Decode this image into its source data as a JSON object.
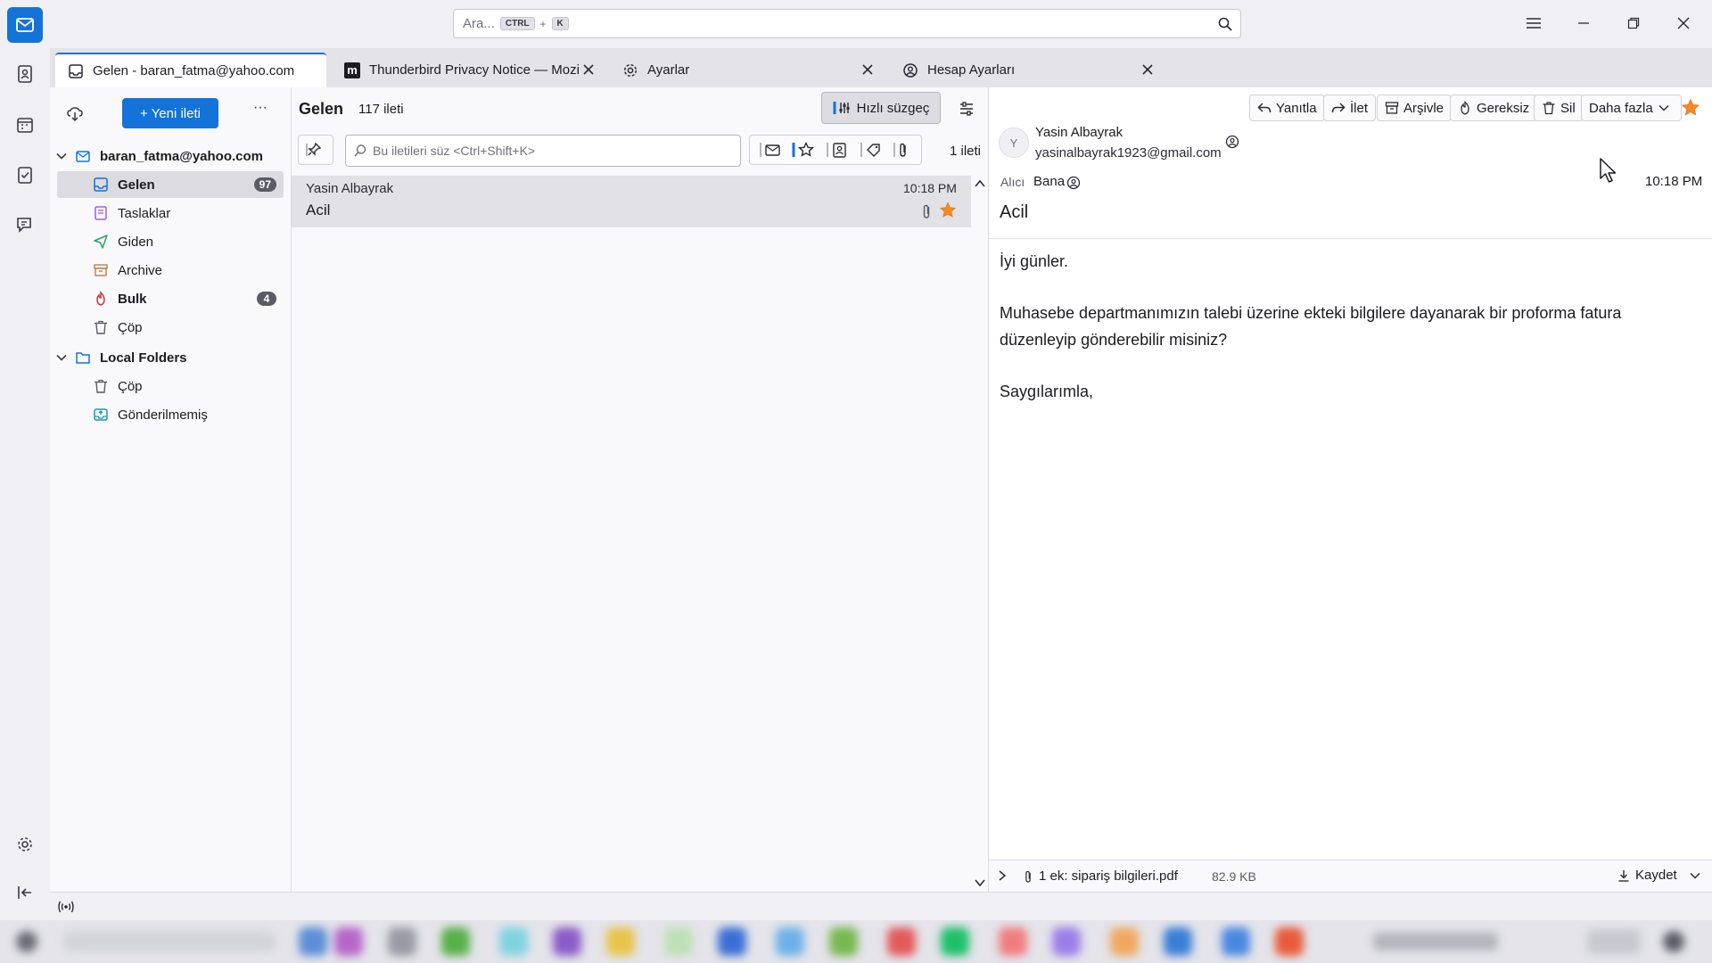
{
  "search": {
    "placeholder": "Ara...",
    "kbd_ctrl": "CTRL",
    "kbd_plus": "+",
    "kbd_k": "K"
  },
  "tabs": [
    {
      "label": "Gelen - baran_fatma@yahoo.com",
      "icon": "inbox-icon"
    },
    {
      "label": "Thunderbird Privacy Notice — Mozilla",
      "icon": "mozilla-icon"
    },
    {
      "label": "Ayarlar",
      "icon": "gear-icon"
    },
    {
      "label": "Hesap Ayarları",
      "icon": "account-settings-icon"
    }
  ],
  "folderpane": {
    "new_message_label": "+ Yeni ileti",
    "more_label": "···",
    "account": "baran_fatma@yahoo.com",
    "folders": [
      {
        "label": "Gelen",
        "badge": "97",
        "icon": "inbox-icon",
        "color": "#1373d9"
      },
      {
        "label": "Taslaklar",
        "badge": "",
        "icon": "drafts-icon",
        "color": "#a25be0"
      },
      {
        "label": "Giden",
        "badge": "",
        "icon": "sent-icon",
        "color": "#2ca55a"
      },
      {
        "label": "Archive",
        "badge": "",
        "icon": "archive-icon",
        "color": "#c0804a"
      },
      {
        "label": "Bulk",
        "badge": "4",
        "icon": "junk-icon",
        "color": "#d9303e"
      },
      {
        "label": "Çöp",
        "badge": "",
        "icon": "trash-icon",
        "color": "#5b5b66"
      }
    ],
    "local_folders": "Local Folders",
    "local": [
      {
        "label": "Çöp",
        "icon": "trash-icon"
      },
      {
        "label": "Gönderilmemiş",
        "icon": "outbox-icon"
      }
    ]
  },
  "threadpane": {
    "folder_title": "Gelen",
    "message_count": "117 ileti",
    "quick_filter_label": "Hızlı süzgeç",
    "filter_placeholder": "Bu iletileri süz <Ctrl+Shift+K>",
    "result_count": "1 ileti",
    "messages": [
      {
        "sender": "Yasin Albayrak",
        "time": "10:18 PM",
        "subject": "Acil"
      }
    ]
  },
  "message": {
    "actions": {
      "reply": "Yanıtla",
      "forward": "İlet",
      "archive": "Arşivle",
      "junk": "Gereksiz",
      "delete": "Sil",
      "more": "Daha fazla"
    },
    "sender_initial": "Y",
    "sender_name": "Yasin Albayrak",
    "sender_email": "yasinalbayrak1923@gmail.com",
    "to_label": "Alıcı",
    "to_value": "Bana",
    "time": "10:18 PM",
    "subject": "Acil",
    "body": [
      "İyi günler.",
      "Muhasebe departmanımızın talebi üzerine ekteki bilgilere dayanarak bir proforma fatura düzenleyip gönderebilir misiniz?",
      "Saygılarımla,"
    ],
    "attachment_label": "1 ek: sipariş bilgileri.pdf",
    "attachment_size": "82.9 KB",
    "save_label": "Kaydet"
  },
  "colors": {
    "accent": "#1373d9",
    "star": "#f68a26"
  }
}
